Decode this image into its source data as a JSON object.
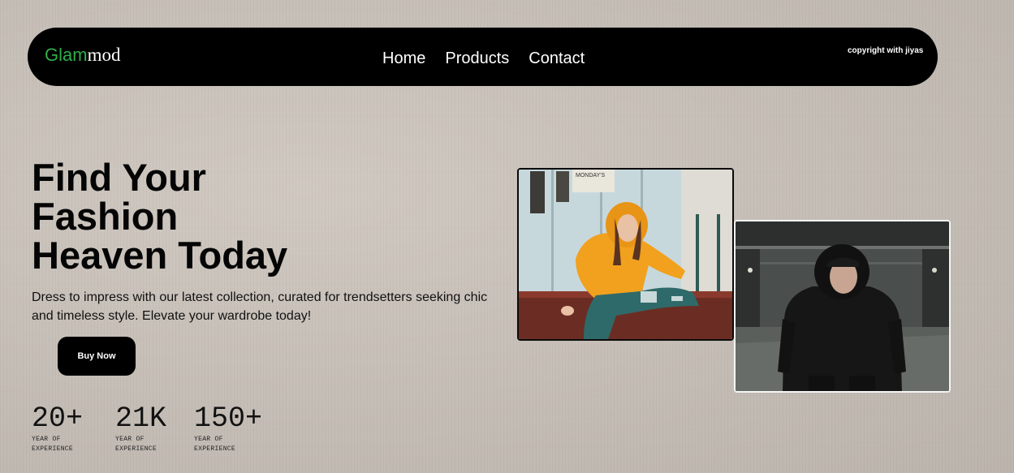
{
  "navbar": {
    "brand_part1": "Glam",
    "brand_part2": "mod",
    "links": [
      "Home",
      "Products",
      "Contact"
    ],
    "copyright": "copyright with jiyas"
  },
  "hero": {
    "title_line1": "Find Your",
    "title_line2": "Fashion",
    "title_line3": "Heaven Today",
    "description": "Dress to impress with our latest collection, curated for trendsetters seeking chic and timeless style. Elevate your wardrobe today!",
    "cta_label": "Buy Now"
  },
  "stats": [
    {
      "value": "20+",
      "label": "YEAR OF EXPERIENCE"
    },
    {
      "value": "21K",
      "label": "YEAR OF EXPERIENCE"
    },
    {
      "value": "150+",
      "label": "YEAR OF EXPERIENCE"
    }
  ],
  "photos": {
    "woman_sign_text": "MONDAY'S"
  },
  "colors": {
    "brand_green": "#2fae48",
    "navbar_bg": "#000000",
    "page_bg": "#c8c1b9"
  }
}
